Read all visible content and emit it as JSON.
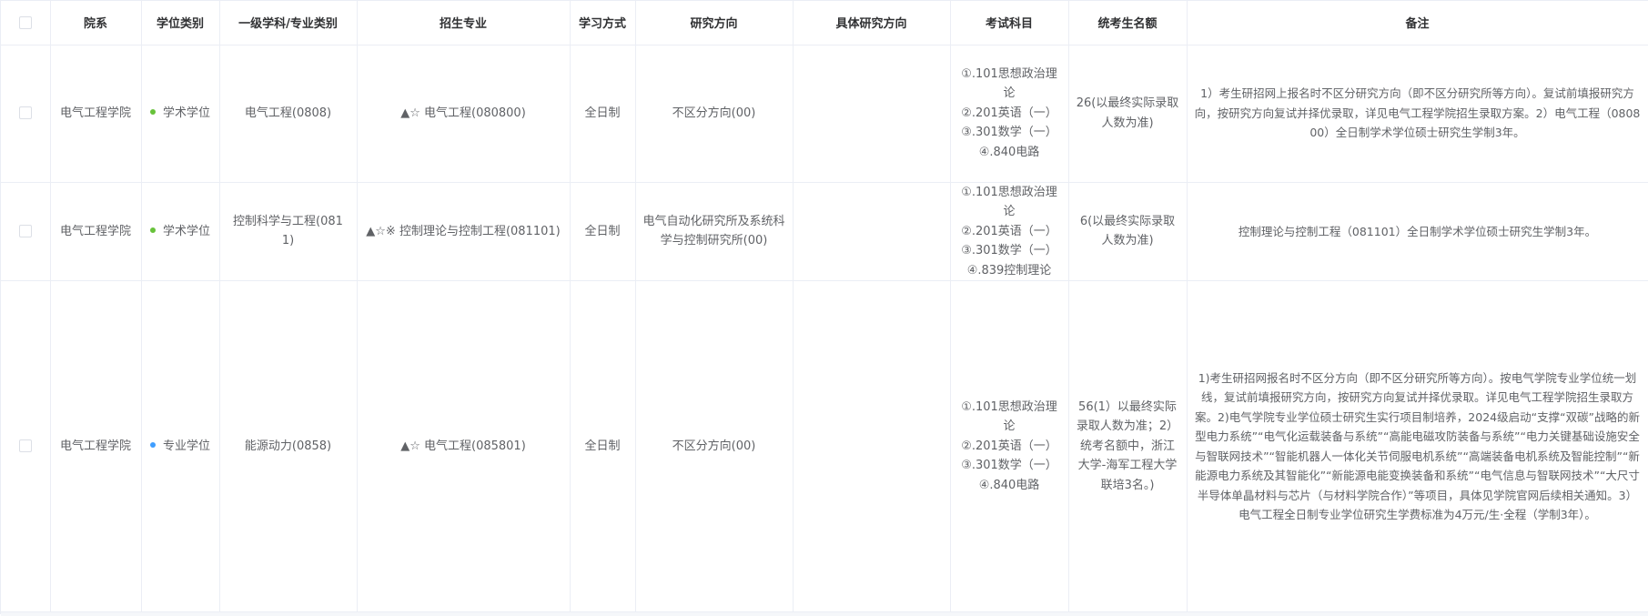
{
  "colors": {
    "academic_dot": "#67c23a",
    "professional_dot": "#409eff",
    "border": "#ebeef5",
    "header_text": "#303133",
    "cell_text": "#606266"
  },
  "headers": {
    "department": "院系",
    "degree_type": "学位类别",
    "discipline": "一级学科/专业类别",
    "major": "招生专业",
    "study_mode": "学习方式",
    "research_direction": "研究方向",
    "specific_direction": "具体研究方向",
    "exam_subjects": "考试科目",
    "quota": "统考生名额",
    "notes": "备注"
  },
  "rows": [
    {
      "department": "电气工程学院",
      "degree_type": "学术学位",
      "degree_color": "#67c23a",
      "discipline": "电气工程(0808)",
      "major": "▲☆ 电气工程(080800)",
      "study_mode": "全日制",
      "research_direction": "不区分方向(00)",
      "specific_direction": "",
      "exam_1": "①.101思想政治理论",
      "exam_2": "②.201英语（一）",
      "exam_3": "③.301数学（一）",
      "exam_4": "④.840电路",
      "quota": "26(以最终实际录取人数为准)",
      "notes": "1）考生研招网上报名时不区分研究方向（即不区分研究所等方向）。复试前填报研究方向，按研究方向复试并择优录取，详见电气工程学院招生录取方案。2）电气工程（080800）全日制学术学位硕士研究生学制3年。"
    },
    {
      "department": "电气工程学院",
      "degree_type": "学术学位",
      "degree_color": "#67c23a",
      "discipline": "控制科学与工程(0811)",
      "major": "▲☆※ 控制理论与控制工程(081101)",
      "study_mode": "全日制",
      "research_direction": "电气自动化研究所及系统科学与控制研究所(00)",
      "specific_direction": "",
      "exam_1": "①.101思想政治理论",
      "exam_2": "②.201英语（一）",
      "exam_3": "③.301数学（一）",
      "exam_4": "④.839控制理论",
      "quota": "6(以最终实际录取人数为准)",
      "notes": "控制理论与控制工程（081101）全日制学术学位硕士研究生学制3年。"
    },
    {
      "department": "电气工程学院",
      "degree_type": "专业学位",
      "degree_color": "#409eff",
      "discipline": "能源动力(0858)",
      "major": "▲☆ 电气工程(085801)",
      "study_mode": "全日制",
      "research_direction": "不区分方向(00)",
      "specific_direction": "",
      "exam_1": "①.101思想政治理论",
      "exam_2": "②.201英语（一）",
      "exam_3": "③.301数学（一）",
      "exam_4": "④.840电路",
      "quota": "56(1）以最终实际录取人数为准；2）统考名额中，浙江大学-海军工程大学联培3名。)",
      "notes": "1)考生研招网报名时不区分方向（即不区分研究所等方向）。按电气学院专业学位统一划线，复试前填报研究方向，按研究方向复试并择优录取。详见电气工程学院招生录取方案。2)电气学院专业学位硕士研究生实行项目制培养，2024级启动“支撑“双碳”战略的新型电力系统”“电气化运载装备与系统”“高能电磁攻防装备与系统”“电力关键基础设施安全与智联网技术”“智能机器人一体化关节伺服电机系统”“高端装备电机系统及智能控制”“新能源电力系统及其智能化”“新能源电能变换装备和系统”“电气信息与智联网技术”“大尺寸半导体单晶材料与芯片（与材料学院合作）”等项目，具体见学院官网后续相关通知。3）电气工程全日制专业学位研究生学费标准为4万元/生·全程（学制3年）。"
    }
  ]
}
